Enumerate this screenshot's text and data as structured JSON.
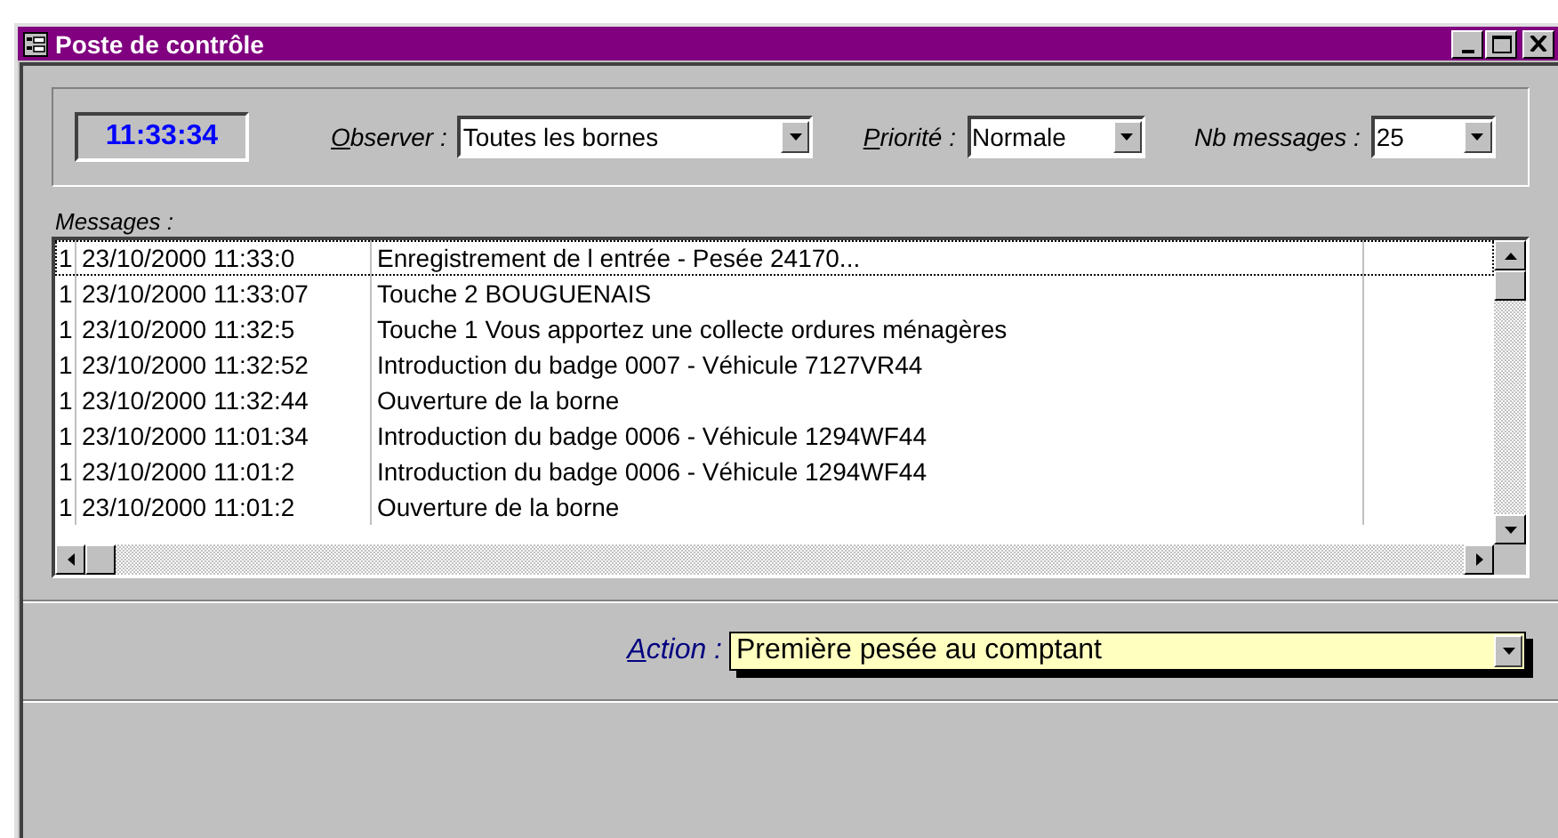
{
  "window": {
    "title": "Poste de contrôle"
  },
  "clock": "11:33:34",
  "filters": [
    {
      "label": "Observer :",
      "mnemonic": true,
      "value": "Toutes les bornes"
    },
    {
      "label": "Priorité :",
      "mnemonic": true,
      "value": "Normale"
    },
    {
      "label": "Nb messages :",
      "mnemonic": false,
      "value": "25"
    }
  ],
  "messages": {
    "label": "Messages :",
    "rows": [
      {
        "selected": true,
        "priority": "1",
        "date": "23/10/2000 11:33:0",
        "text": "Enregistrement de l entrée - Pesée 24170..."
      },
      {
        "selected": false,
        "priority": "1",
        "date": "23/10/2000 11:33:07",
        "text": "Touche 2 BOUGUENAIS"
      },
      {
        "selected": false,
        "priority": "1",
        "date": "23/10/2000 11:32:5",
        "text": "Touche 1 Vous apportez une collecte ordures ménagères"
      },
      {
        "selected": false,
        "priority": "1",
        "date": "23/10/2000 11:32:52",
        "text": "Introduction du badge 0007 - Véhicule 7127VR44"
      },
      {
        "selected": false,
        "priority": "1",
        "date": "23/10/2000 11:32:44",
        "text": "Ouverture de la borne"
      },
      {
        "selected": false,
        "priority": "1",
        "date": "23/10/2000 11:01:34",
        "text": "Introduction du badge 0006 - Véhicule 1294WF44"
      },
      {
        "selected": false,
        "priority": "1",
        "date": "23/10/2000 11:01:2",
        "text": "Introduction du badge 0006 - Véhicule 1294WF44"
      },
      {
        "selected": false,
        "priority": "1",
        "date": "23/10/2000 11:01:2",
        "text": "Ouverture de la borne"
      }
    ]
  },
  "action": {
    "label": "Action :",
    "mnemonic": true,
    "value": "Première pesée au comptant"
  }
}
